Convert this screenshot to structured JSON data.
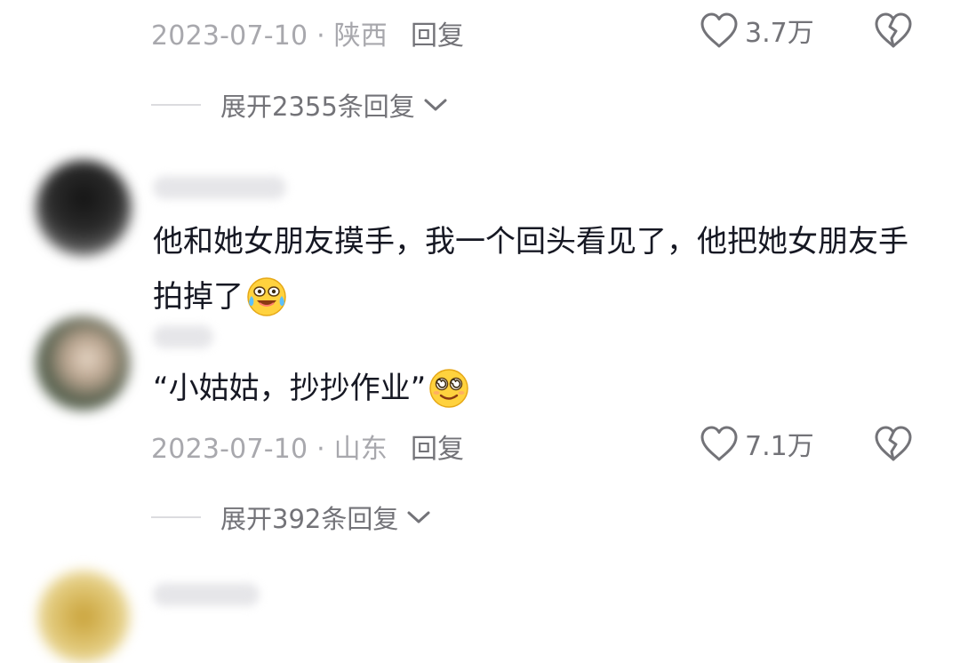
{
  "comment_top": {
    "date": "2023-07-10",
    "location": "陕西",
    "reply_label": "回复",
    "like_count": "3.7万",
    "expand_label": "展开2355条回复"
  },
  "comment_1": {
    "text_before_emoji": "他和她女朋友摸手，我一个回头看见了，他把她女朋友手拍掉了",
    "emoji": "crying-laughing-emoji"
  },
  "comment_2": {
    "text_before_emoji": "“小姑姑，抄抄作业”",
    "emoji": "dizzy-smile-emoji",
    "date": "2023-07-10",
    "location": "山东",
    "reply_label": "回复",
    "like_count": "7.1万",
    "expand_label": "展开392条回复"
  },
  "separator": " · ",
  "colors": {
    "text_primary": "#161823",
    "text_secondary": "#737378",
    "text_tertiary": "#a8a8ad",
    "background": "#ffffff"
  }
}
